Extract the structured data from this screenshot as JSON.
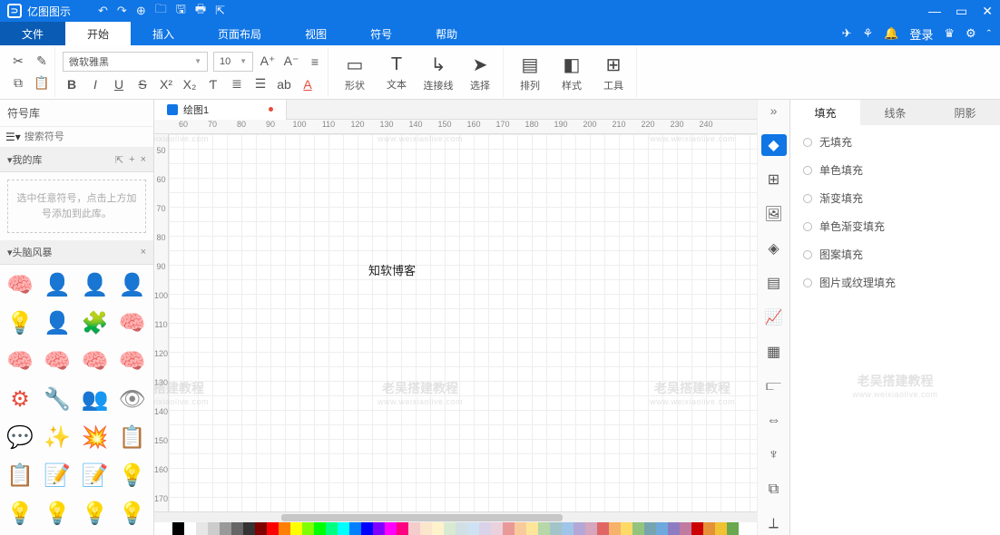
{
  "app": {
    "title": "亿图图示"
  },
  "menu": {
    "file": "文件",
    "start": "开始",
    "insert": "插入",
    "layout": "页面布局",
    "view": "视图",
    "symbol": "符号",
    "help": "帮助",
    "login": "登录"
  },
  "font": {
    "name": "微软雅黑",
    "size": "10"
  },
  "ribbon": {
    "shape": "形状",
    "text": "文本",
    "connector": "连接线",
    "select": "选择",
    "arrange": "排列",
    "style": "样式",
    "tool": "工具"
  },
  "left": {
    "title": "符号库",
    "search_ph": "搜索符号",
    "mylib": "我的库",
    "empty": "选中任意符号，点击上方加号添加到此库。",
    "brainstorm": "头脑风暴"
  },
  "doc": {
    "tab": "绘图1",
    "canvas_text": "知软博客",
    "watermark": "老吴搭建教程",
    "watermark_sub": "www.weixiaolive.com"
  },
  "ruler_h": [
    "60",
    "70",
    "80",
    "90",
    "100",
    "110",
    "120",
    "130",
    "140",
    "150",
    "160",
    "170",
    "180",
    "190",
    "200",
    "210",
    "220",
    "230",
    "240"
  ],
  "ruler_v": [
    "50",
    "60",
    "70",
    "80",
    "90",
    "100",
    "110",
    "120",
    "130",
    "140",
    "150",
    "160",
    "170"
  ],
  "right": {
    "fill": "填充",
    "line": "线条",
    "shadow": "阴影",
    "opts": {
      "none": "无填充",
      "solid": "单色填充",
      "gradient": "渐变填充",
      "solidgrad": "单色渐变填充",
      "pattern": "图案填充",
      "image": "图片或纹理填充"
    }
  },
  "palette": [
    "#000",
    "#fff",
    "#e6e6e6",
    "#ccc",
    "#999",
    "#666",
    "#333",
    "#800000",
    "#f00",
    "#ff8000",
    "#ff0",
    "#80ff00",
    "#0f0",
    "#00ff80",
    "#0ff",
    "#0080ff",
    "#00f",
    "#8000ff",
    "#f0f",
    "#ff0080",
    "#f4cccc",
    "#fce5cd",
    "#fff2cc",
    "#d9ead3",
    "#d0e0e3",
    "#cfe2f3",
    "#d9d2e9",
    "#ead1dc",
    "#ea9999",
    "#f9cb9c",
    "#ffe599",
    "#b6d7a8",
    "#a2c4c9",
    "#9fc5e8",
    "#b4a7d6",
    "#d5a6bd",
    "#e06666",
    "#f6b26b",
    "#ffd966",
    "#93c47d",
    "#76a5af",
    "#6fa8dc",
    "#8e7cc3",
    "#c27ba0",
    "#cc0000",
    "#e69138",
    "#f1c232",
    "#6aa84f"
  ],
  "symbols": [
    {
      "g": "🧠",
      "c": "#7b5be0"
    },
    {
      "g": "👤",
      "c": "#7b5be0"
    },
    {
      "g": "👤",
      "c": "#f4c541"
    },
    {
      "g": "👤",
      "c": "#222"
    },
    {
      "g": "💡",
      "c": "#f4c541"
    },
    {
      "g": "👤",
      "c": "#2a7de1"
    },
    {
      "g": "🧩",
      "c": "#e74c3c"
    },
    {
      "g": "🧠",
      "c": "#1b2a4e"
    },
    {
      "g": "🧠",
      "c": "#f29cb7"
    },
    {
      "g": "🧠",
      "c": "#f29cb7"
    },
    {
      "g": "🧠",
      "c": "#f29cb7"
    },
    {
      "g": "🧠",
      "c": "#f29cb7"
    },
    {
      "g": "⚙",
      "c": "#e74c3c"
    },
    {
      "g": "🔧",
      "c": "#f4c541"
    },
    {
      "g": "👥",
      "c": "#e67e22"
    },
    {
      "g": "👁",
      "c": "#888"
    },
    {
      "g": "💬",
      "c": "#e67e22"
    },
    {
      "g": "✨",
      "c": "#f4c541"
    },
    {
      "g": "💥",
      "c": "#f4c541"
    },
    {
      "g": "📋",
      "c": "#f29cb7"
    },
    {
      "g": "📋",
      "c": "#e74c3c"
    },
    {
      "g": "📝",
      "c": "#555"
    },
    {
      "g": "📝",
      "c": "#f4c541"
    },
    {
      "g": "💡",
      "c": "#f4c541"
    },
    {
      "g": "💡",
      "c": "#f4c541"
    },
    {
      "g": "💡",
      "c": "#2a7de1"
    },
    {
      "g": "💡",
      "c": "#27ae60"
    },
    {
      "g": "💡",
      "c": "#1b2a4e"
    }
  ]
}
